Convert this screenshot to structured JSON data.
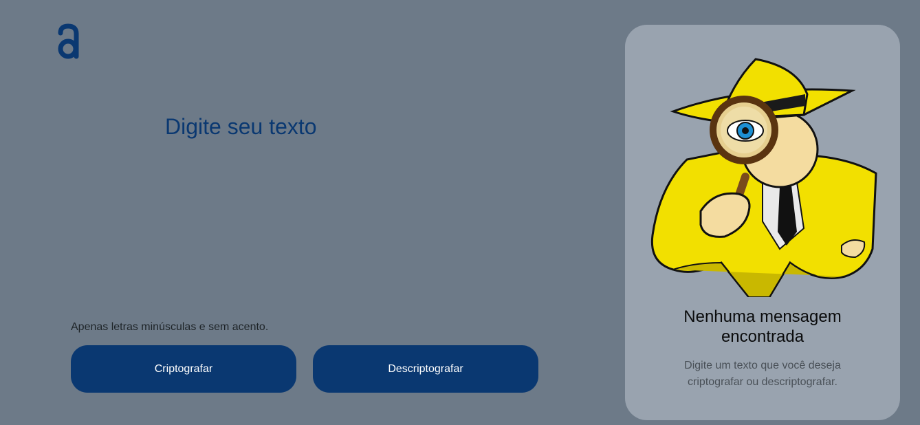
{
  "input": {
    "placeholder": "Digite seu texto",
    "value": ""
  },
  "hint": {
    "text": "Apenas letras minúsculas e sem acento."
  },
  "buttons": {
    "encrypt_label": "Criptografar",
    "decrypt_label": "Descriptografar"
  },
  "output": {
    "title": "Nenhuma mensagem encontrada",
    "subtitle": "Digite um texto que você deseja criptografar ou descriptografar."
  },
  "colors": {
    "background": "#6d7a88",
    "accent": "#0a3871",
    "panel": "#99a3af"
  },
  "icons": {
    "logo": "alura-logo-icon",
    "illustration": "detective-magnifier-illustration"
  }
}
